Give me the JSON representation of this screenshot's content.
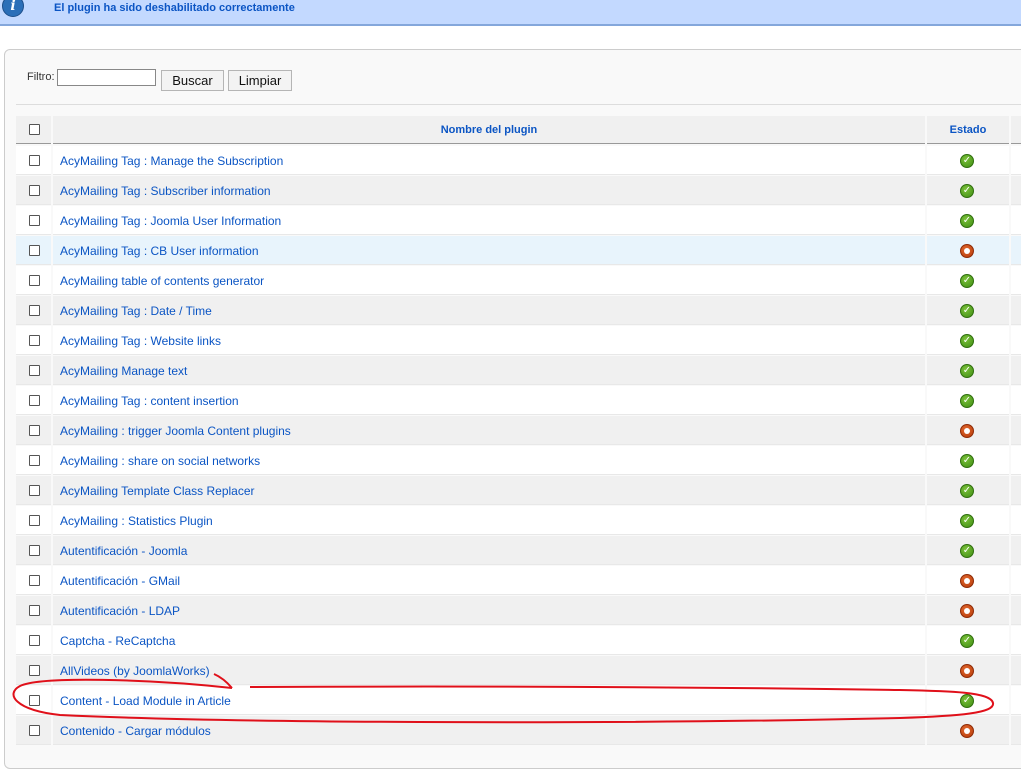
{
  "message": {
    "text": "El plugin ha sido deshabilitado correctamente",
    "icon": "info-icon"
  },
  "filter": {
    "label": "Filtro:",
    "value": "",
    "search_label": "Buscar",
    "reset_label": "Limpiar"
  },
  "table": {
    "headers": {
      "name": "Nombre del plugin",
      "state": "Estado"
    },
    "rows": [
      {
        "name": "AcyMailing Tag : Manage the Subscription",
        "enabled": true
      },
      {
        "name": "AcyMailing Tag : Subscriber information",
        "enabled": true
      },
      {
        "name": "AcyMailing Tag : Joomla User Information",
        "enabled": true
      },
      {
        "name": "AcyMailing Tag : CB User information",
        "enabled": false
      },
      {
        "name": "AcyMailing table of contents generator",
        "enabled": true
      },
      {
        "name": "AcyMailing Tag : Date / Time",
        "enabled": true
      },
      {
        "name": "AcyMailing Tag : Website links",
        "enabled": true
      },
      {
        "name": "AcyMailing Manage text",
        "enabled": true
      },
      {
        "name": "AcyMailing Tag : content insertion",
        "enabled": true
      },
      {
        "name": "AcyMailing : trigger Joomla Content plugins",
        "enabled": false
      },
      {
        "name": "AcyMailing : share on social networks",
        "enabled": true
      },
      {
        "name": "AcyMailing Template Class Replacer",
        "enabled": true
      },
      {
        "name": "AcyMailing : Statistics Plugin",
        "enabled": true
      },
      {
        "name": "Autentificación - Joomla",
        "enabled": true
      },
      {
        "name": "Autentificación - GMail",
        "enabled": false
      },
      {
        "name": "Autentificación - LDAP",
        "enabled": false
      },
      {
        "name": "Captcha - ReCaptcha",
        "enabled": true
      },
      {
        "name": "AllVideos (by JoomlaWorks)",
        "enabled": false
      },
      {
        "name": "Content - Load Module in Article",
        "enabled": true
      },
      {
        "name": "Contenido - Cargar módulos",
        "enabled": false
      }
    ]
  },
  "colors": {
    "accent": "#0b55c4",
    "banner": "#c3d9ff",
    "enabled": "#4a9a1c",
    "disabled": "#c24a14",
    "annotation": "#e0101a"
  }
}
